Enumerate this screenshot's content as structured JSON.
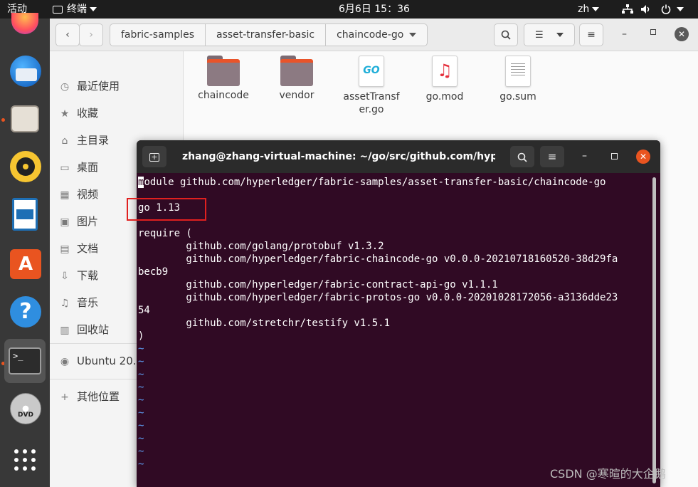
{
  "topbar": {
    "activities": "活动",
    "app_name": "终端",
    "clock": "6月6日  15：36",
    "lang": "zh"
  },
  "files": {
    "breadcrumbs": [
      "fabric-samples",
      "asset-transfer-basic",
      "chaincode-go"
    ],
    "sidebar": [
      {
        "icon": "clock-icon",
        "label": "最近使用"
      },
      {
        "icon": "star-icon",
        "label": "收藏"
      },
      {
        "icon": "home-icon",
        "label": "主目录"
      },
      {
        "icon": "desktop-icon",
        "label": "桌面"
      },
      {
        "icon": "video-icon",
        "label": "视频"
      },
      {
        "icon": "image-icon",
        "label": "图片"
      },
      {
        "icon": "document-icon",
        "label": "文档"
      },
      {
        "icon": "download-icon",
        "label": "下载"
      },
      {
        "icon": "music-icon",
        "label": "音乐"
      },
      {
        "icon": "trash-icon",
        "label": "回收站"
      },
      {
        "icon": "disk-icon",
        "label": "Ubuntu 20.0..."
      },
      {
        "icon": "plus-icon",
        "label": "其他位置"
      }
    ],
    "items": [
      {
        "type": "folder",
        "label": "chaincode"
      },
      {
        "type": "folder",
        "label": "vendor"
      },
      {
        "type": "go",
        "label": "assetTransf",
        "label2": "er.go"
      },
      {
        "type": "music",
        "label": "go.mod"
      },
      {
        "type": "text",
        "label": "go.sum"
      }
    ]
  },
  "terminal": {
    "title": "zhang@zhang-virtual-machine: ~/go/src/github.com/hyperle...",
    "cursor_char": "m",
    "lines": [
      "odule github.com/hyperledger/fabric-samples/asset-transfer-basic/chaincode-go",
      "",
      "go 1.13",
      "",
      "require (",
      "        github.com/golang/protobuf v1.3.2",
      "        github.com/hyperledger/fabric-chaincode-go v0.0.0-20210718160520-38d29fa",
      "becb9",
      "        github.com/hyperledger/fabric-contract-api-go v1.1.1",
      "        github.com/hyperledger/fabric-protos-go v0.0.0-20201028172056-a3136dde23",
      "54",
      "        github.com/stretchr/testify v1.5.1",
      ")"
    ],
    "tilde": "~"
  },
  "watermark": "CSDN @寒暄的大企鹅",
  "colors": {
    "accent": "#e95420",
    "terminal_bg": "#300a24",
    "highlight_box": "#e0201f"
  }
}
